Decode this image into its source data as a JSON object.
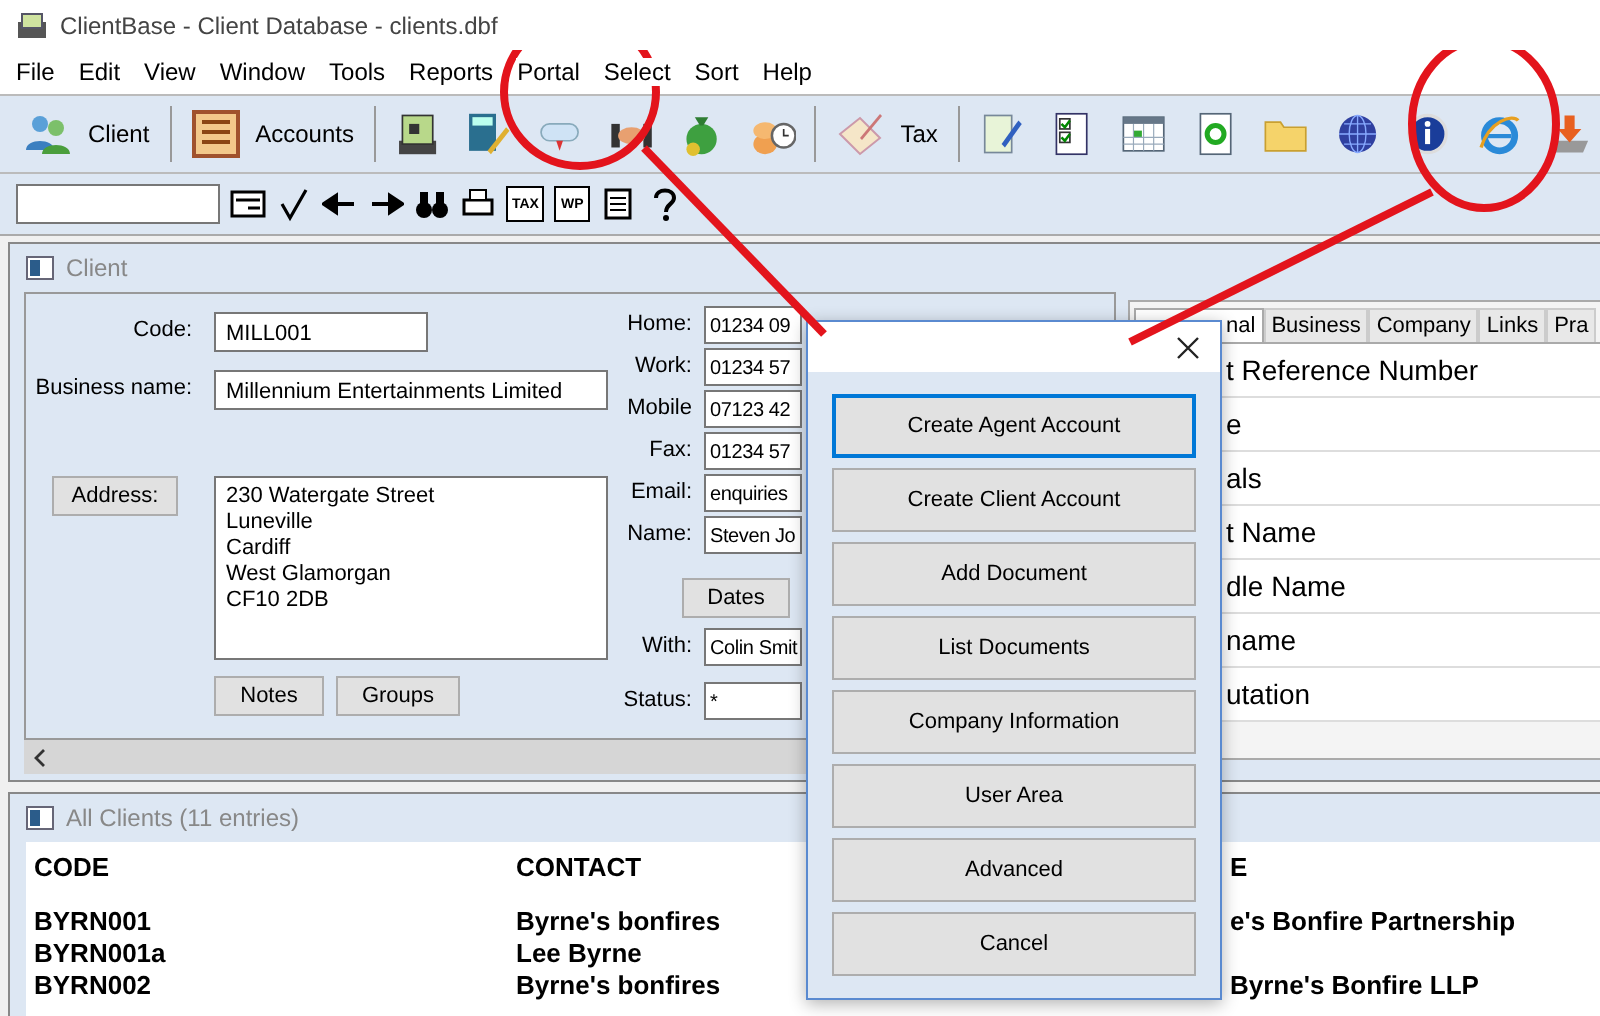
{
  "window": {
    "title": "ClientBase - Client Database - clients.dbf"
  },
  "menu": [
    "File",
    "Edit",
    "View",
    "Window",
    "Tools",
    "Reports",
    "Portal",
    "Select",
    "Sort",
    "Help"
  ],
  "toolbar": {
    "client": "Client",
    "accounts": "Accounts",
    "tax": "Tax"
  },
  "quickbar": {
    "tax_icon": "TAX",
    "wp_icon": "WP"
  },
  "client_window": {
    "title": "Client",
    "code_label": "Code:",
    "code": "MILL001",
    "business_label": "Business name:",
    "business": "Millennium Entertainments Limited",
    "address_button": "Address:",
    "address_lines": [
      "230 Watergate Street",
      "Luneville",
      "Cardiff",
      "West Glamorgan",
      "CF10 2DB"
    ],
    "notes_button": "Notes",
    "groups_button": "Groups",
    "contact_fields": [
      {
        "label": "Home:",
        "value": "01234 09"
      },
      {
        "label": "Work:",
        "value": "01234 57"
      },
      {
        "label": "Mobile",
        "value": "07123 42"
      },
      {
        "label": "Fax:",
        "value": "01234 57"
      },
      {
        "label": "Email:",
        "value": "enquiries"
      },
      {
        "label": "Name:",
        "value": "Steven Jo"
      }
    ],
    "dates_button": "Dates",
    "with_label": "With:",
    "with": "Colin Smit",
    "status_label": "Status:",
    "status": "*"
  },
  "detail_panel": {
    "tabs": [
      {
        "label": "nal",
        "selected": true
      },
      {
        "label": "Business",
        "selected": false
      },
      {
        "label": "Company",
        "selected": false
      },
      {
        "label": "Links",
        "selected": false
      },
      {
        "label": "Pra",
        "selected": false
      }
    ],
    "fields": [
      "t Reference Number",
      "e",
      "als",
      "t Name",
      "dle Name",
      "name",
      "utation"
    ]
  },
  "list_window": {
    "title": "All Clients (11 entries)",
    "columns": [
      "CODE",
      "CONTACT",
      "E"
    ],
    "rows": [
      [
        "BYRN001",
        "Byrne's bonfires",
        "e's Bonfire Partnership"
      ],
      [
        "BYRN001a",
        "Lee Byrne"
      ],
      [
        "BYRN002",
        "Byrne's bonfires",
        "Byrne's Bonfire LLP"
      ]
    ]
  },
  "portal_dialog": {
    "buttons": [
      {
        "label": "Create Agent Account",
        "selected": true
      },
      {
        "label": "Create Client Account",
        "selected": false
      },
      {
        "label": "Add Document",
        "selected": false
      },
      {
        "label": "List Documents",
        "selected": false
      },
      {
        "label": "Company Information",
        "selected": false
      },
      {
        "label": "User Area",
        "selected": false
      },
      {
        "label": "Advanced",
        "selected": false
      },
      {
        "label": "Cancel",
        "selected": false
      }
    ]
  }
}
